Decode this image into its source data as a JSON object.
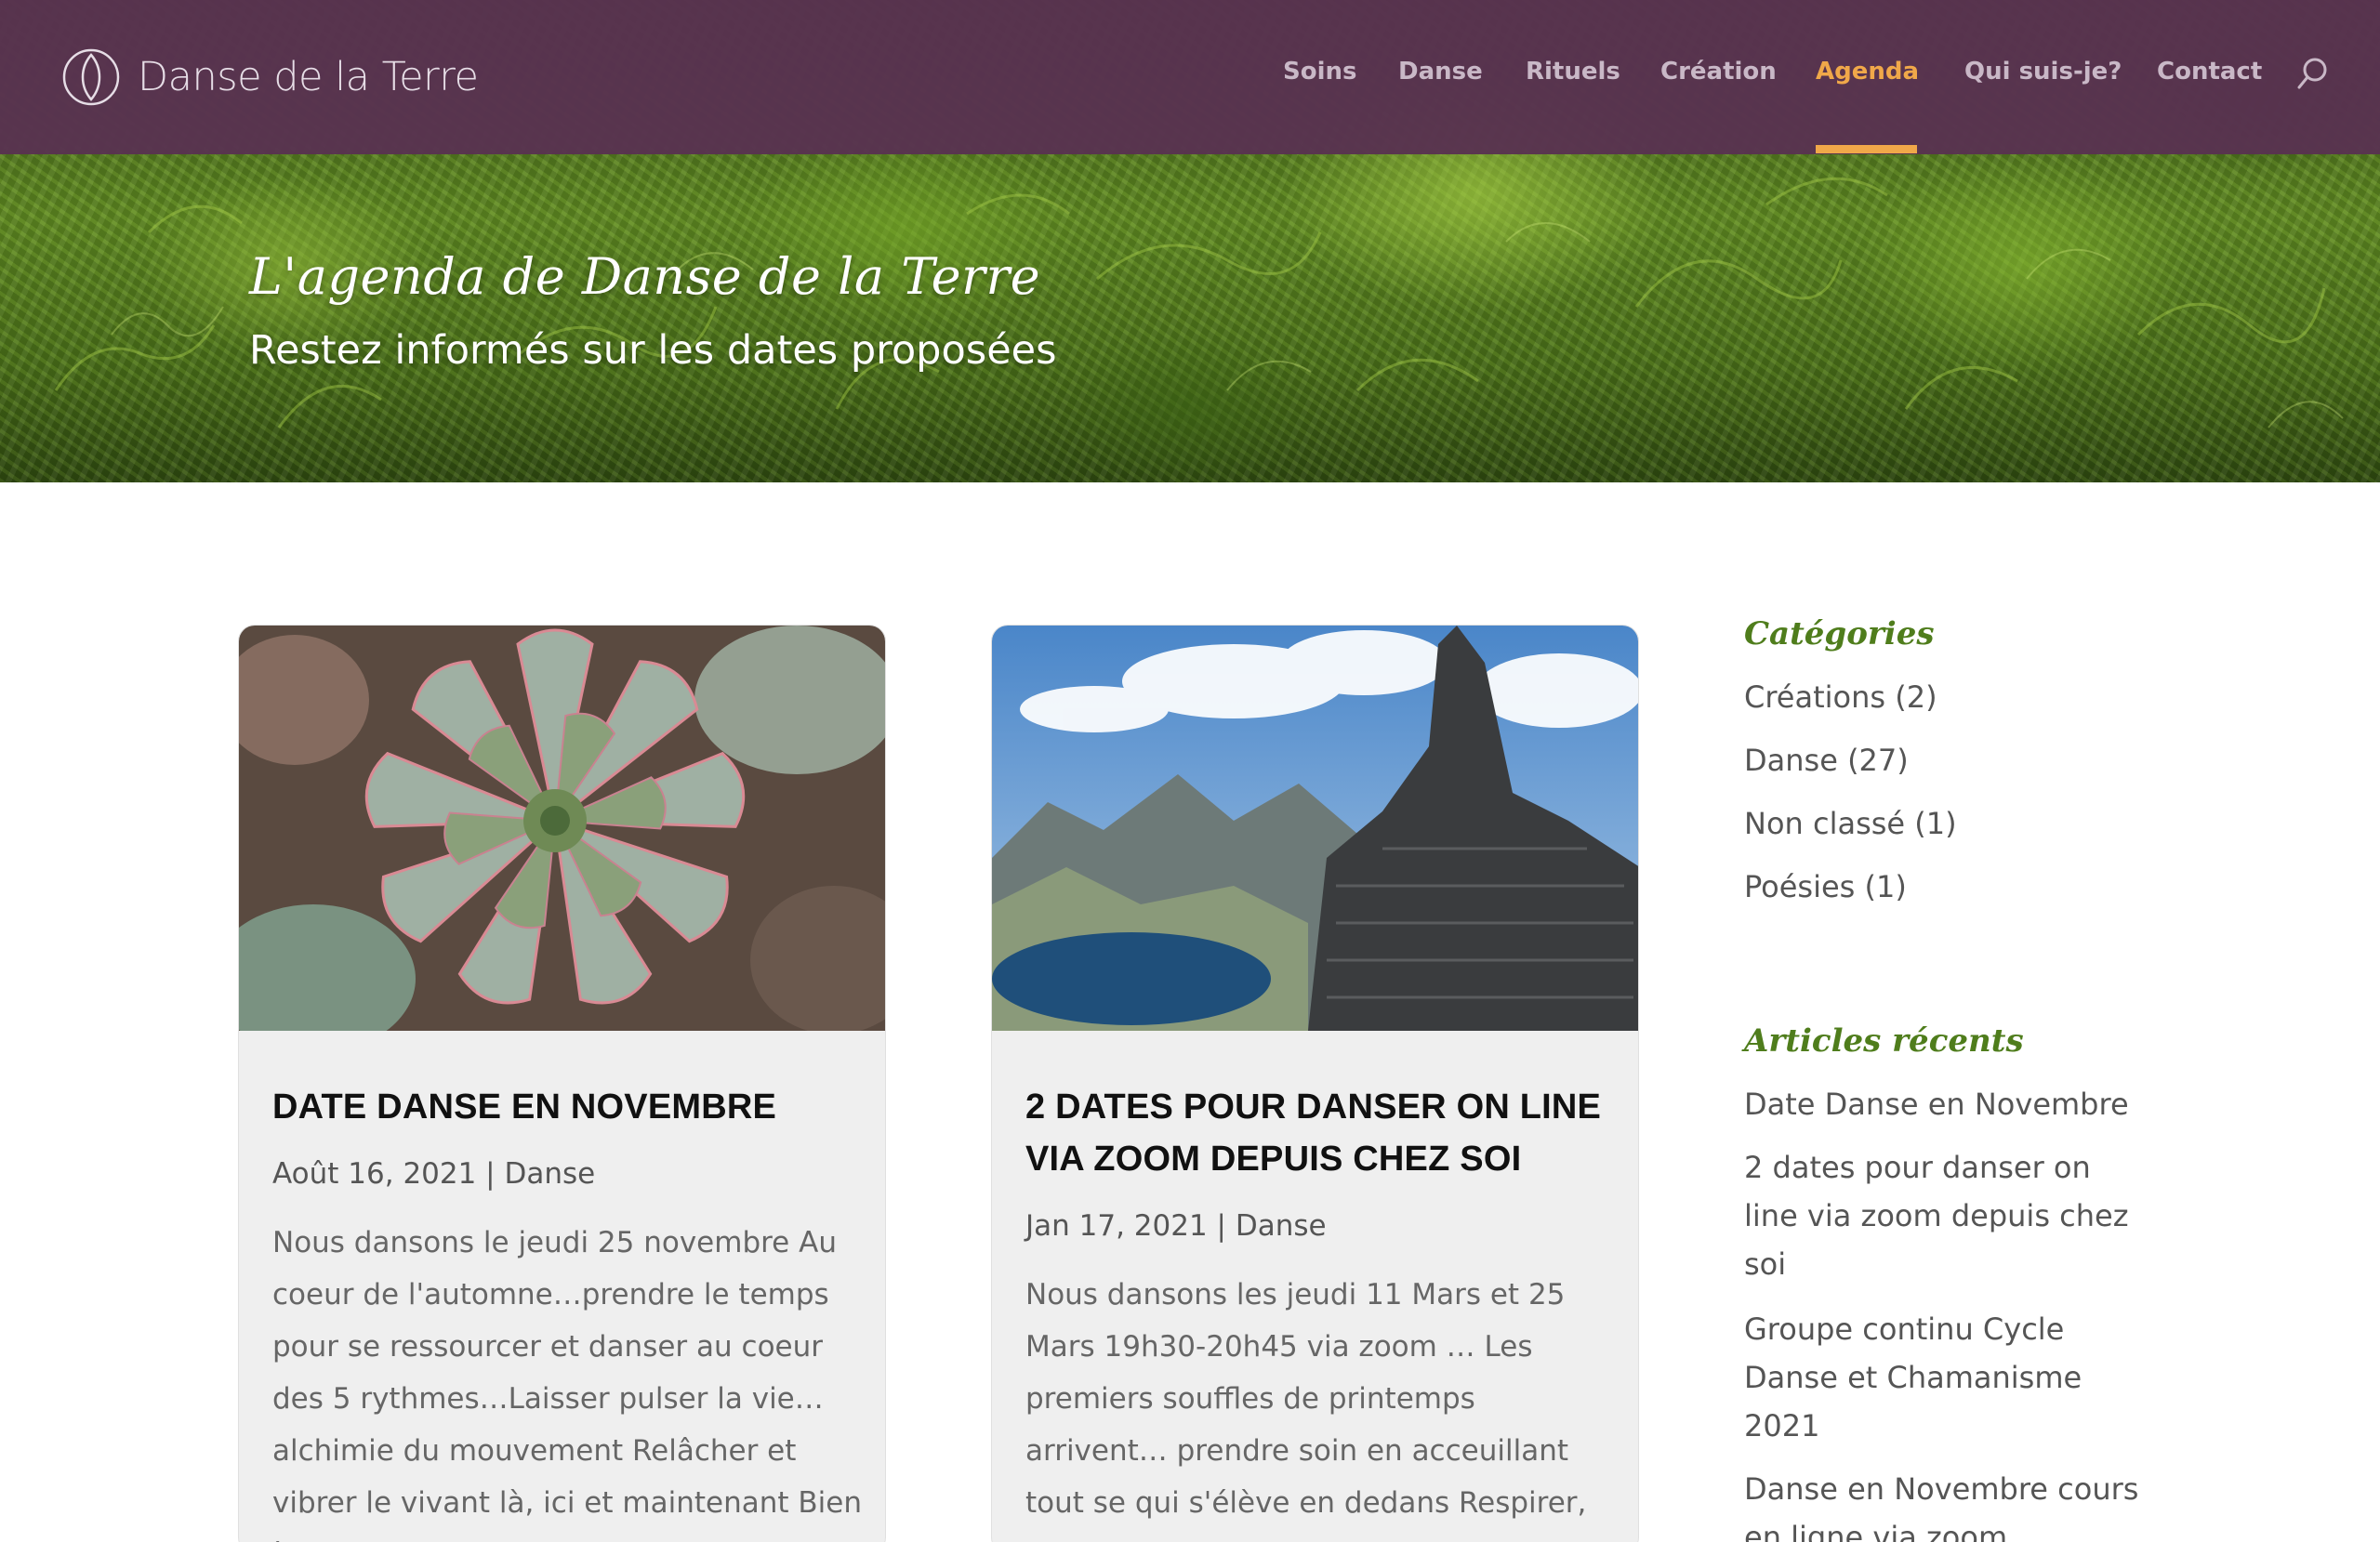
{
  "site": {
    "logo_text": "Danse de la Terre"
  },
  "nav": {
    "items": [
      {
        "label": "Soins"
      },
      {
        "label": "Danse"
      },
      {
        "label": "Rituels"
      },
      {
        "label": "Création"
      },
      {
        "label": "Agenda",
        "active": true
      },
      {
        "label": "Qui suis-je?"
      },
      {
        "label": "Contact"
      }
    ],
    "active_color": "#f0a849",
    "search_icon": "search-icon"
  },
  "hero": {
    "title": "L'agenda de Danse de la Terre",
    "subtitle": "Restez informés sur les dates proposées"
  },
  "posts": [
    {
      "title": "Date Danse en Novembre",
      "meta": "Août 16, 2021 | Danse",
      "excerpt": "Nous dansons le jeudi  25 novembre Au coeur de l'automne…prendre le temps pour se ressourcer et danser au coeur des 5 rythmes…Laisser pulser la vie…alchimie du mouvement Relâcher et vibrer le vivant là, ici et maintenant Bien à",
      "image": "succulent-plant-photo"
    },
    {
      "title": "2 dates pour danser on line via zoom depuis chez soi",
      "meta": "Jan 17, 2021 | Danse",
      "excerpt": "Nous dansons les jeudi 11 Mars et 25 Mars  19h30-20h45 via zoom … Les premiers souffles de printemps arrivent… prendre soin en acceuillant tout se qui s'élève en dedans Respirer, danser,",
      "image": "mountain-lake-cairn-photo"
    }
  ],
  "sidebar": {
    "categories_title": "Catégories",
    "categories": [
      {
        "label": "Créations (2)"
      },
      {
        "label": "Danse (27)"
      },
      {
        "label": "Non classé (1)"
      },
      {
        "label": "Poésies (1)"
      }
    ],
    "recent_title": "Articles récents",
    "recent": [
      {
        "label": "Date Danse en Novembre"
      },
      {
        "label": "2 dates pour danser on line via zoom depuis chez soi"
      },
      {
        "label": "Groupe continu Cycle Danse et Chamanisme 2021"
      },
      {
        "label": "Danse en Novembre cours en ligne via zoom"
      }
    ]
  },
  "colors": {
    "header_bg": "#583250",
    "accent": "#f0a849",
    "widget_title": "#4f7d1c"
  }
}
